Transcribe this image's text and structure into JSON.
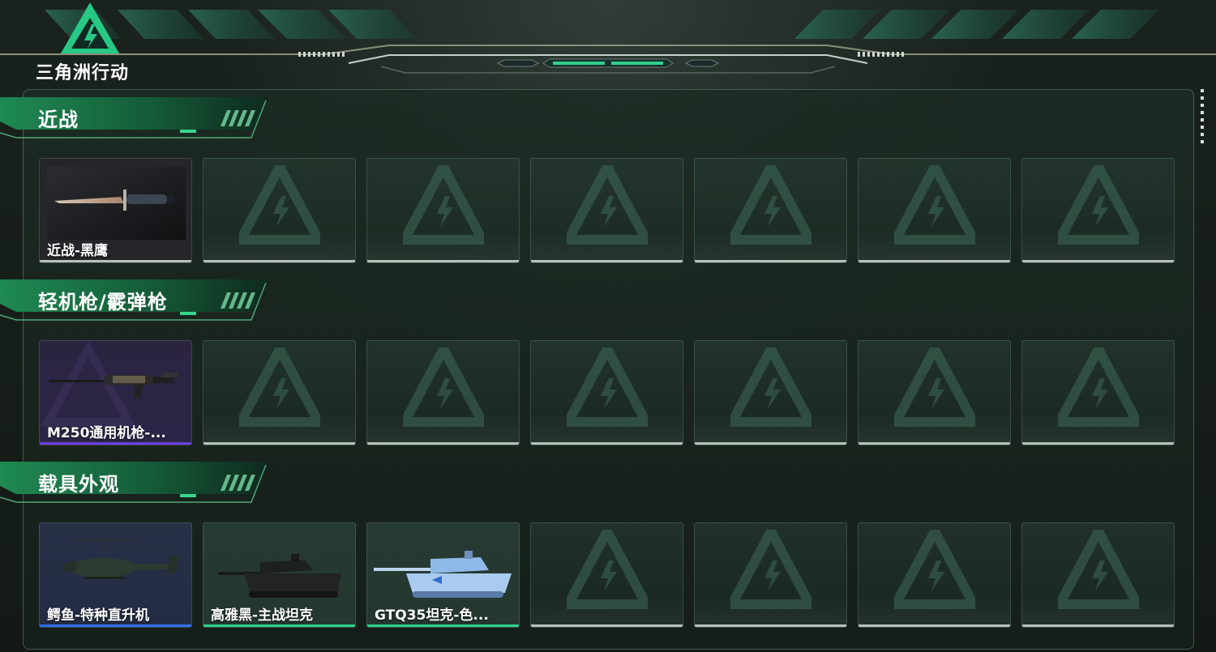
{
  "header": {
    "logo_text": "三角洲行动"
  },
  "sections": [
    {
      "title": "近战",
      "items": [
        {
          "label": "近战-黑鹰",
          "rarity": "none"
        },
        {
          "label": "",
          "rarity": "empty"
        },
        {
          "label": "",
          "rarity": "empty"
        },
        {
          "label": "",
          "rarity": "empty"
        },
        {
          "label": "",
          "rarity": "empty"
        },
        {
          "label": "",
          "rarity": "empty"
        },
        {
          "label": "",
          "rarity": "empty"
        }
      ]
    },
    {
      "title": "轻机枪/霰弹枪",
      "items": [
        {
          "label": "M250通用机枪-...",
          "rarity": "purple"
        },
        {
          "label": "",
          "rarity": "empty"
        },
        {
          "label": "",
          "rarity": "empty"
        },
        {
          "label": "",
          "rarity": "empty"
        },
        {
          "label": "",
          "rarity": "empty"
        },
        {
          "label": "",
          "rarity": "empty"
        },
        {
          "label": "",
          "rarity": "empty"
        }
      ]
    },
    {
      "title": "载具外观",
      "items": [
        {
          "label": "鳄鱼-特种直升机",
          "rarity": "blue"
        },
        {
          "label": "高雅黑-主战坦克",
          "rarity": "green"
        },
        {
          "label": "GTQ35坦克-色...",
          "rarity": "green"
        },
        {
          "label": "",
          "rarity": "empty"
        },
        {
          "label": "",
          "rarity": "empty"
        },
        {
          "label": "",
          "rarity": "empty"
        },
        {
          "label": "",
          "rarity": "empty"
        }
      ]
    }
  ],
  "colors": {
    "accent_green": "#2fd08c",
    "rarity_purple": "#6b3ee0",
    "rarity_blue": "#2f6ef0",
    "banner_green": "#1f7a48"
  }
}
